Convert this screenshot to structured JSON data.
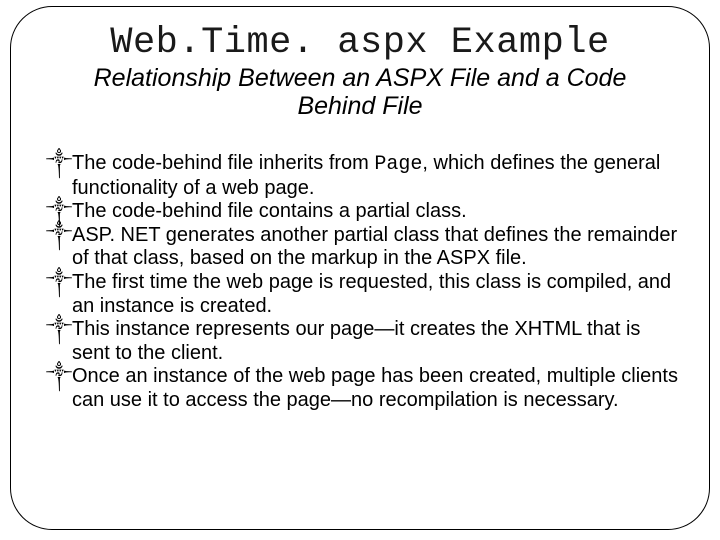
{
  "title": "Web.Time. aspx Example",
  "subtitle": "Relationship Between an ASPX File and a Code Behind File",
  "bullet_glyph": "༒",
  "inline_code": "Page",
  "bullets": [
    {
      "pre": "The code-behind file inherits from ",
      "post": ", which defines the general functionality of a web page."
    },
    {
      "text": "The code-behind file contains a partial class."
    },
    {
      "text": "ASP. NET generates another partial class that defines the remainder of that class, based on the markup in the ASPX file."
    },
    {
      "text": "The first time the web page is requested, this class is compiled, and an instance is created."
    },
    {
      "text": "This instance represents our page—it creates the XHTML that is sent to the client."
    },
    {
      "text": "Once an instance of the web page has been created, multiple clients can use it to access the page—no recompilation is necessary."
    }
  ]
}
